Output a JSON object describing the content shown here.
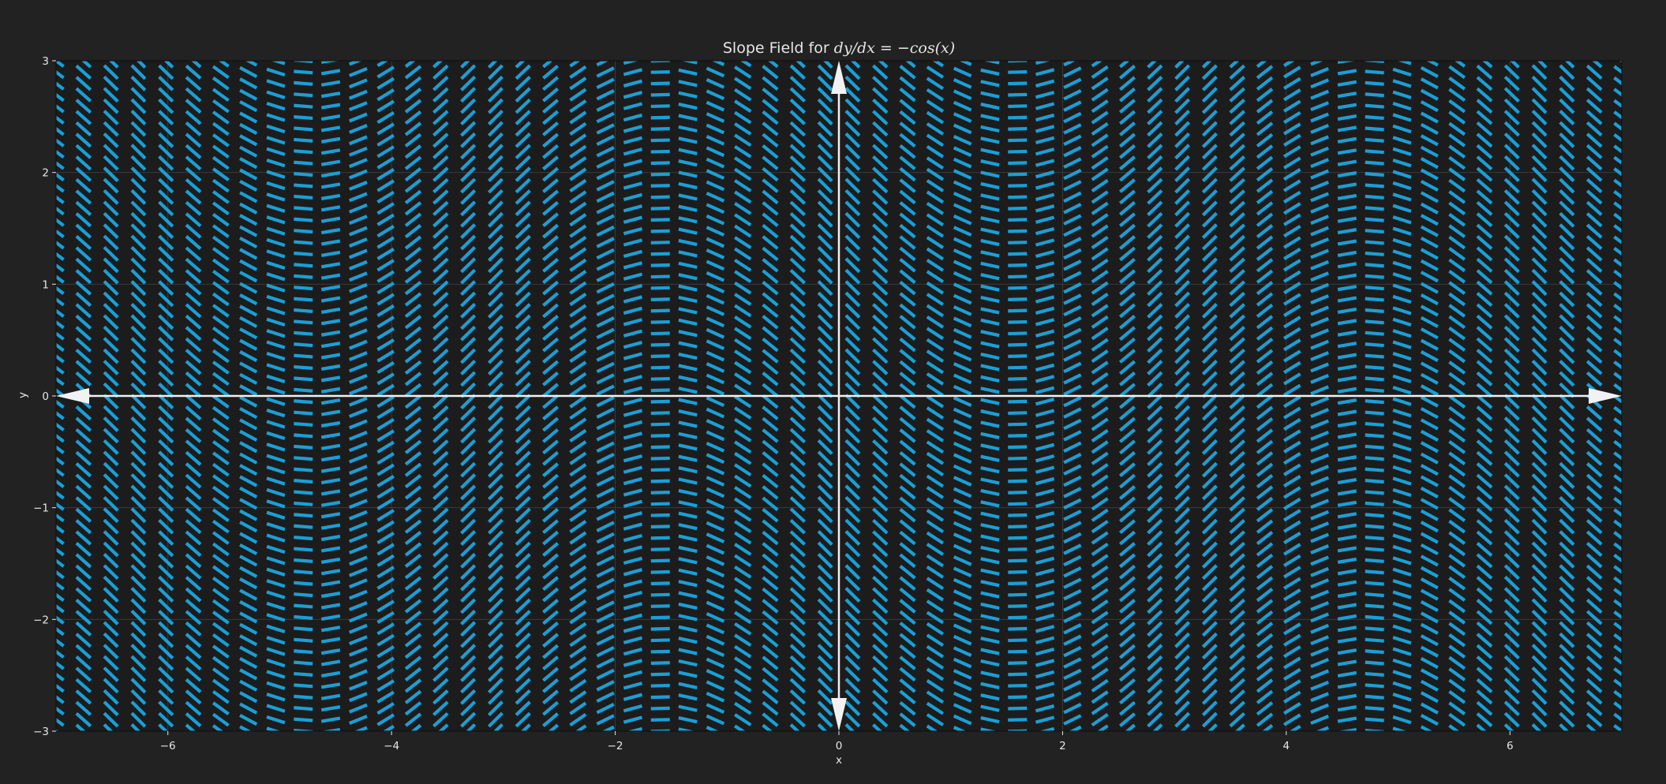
{
  "chart_data": {
    "type": "slope_field",
    "title_prefix": "Slope Field for ",
    "title_math": "dy/dx = −cos(x)",
    "xlabel": "x",
    "ylabel": "y",
    "xlim": [
      -7,
      7
    ],
    "ylim": [
      -3,
      3
    ],
    "xticks": [
      -6,
      -4,
      -2,
      0,
      2,
      4,
      6
    ],
    "xtick_labels": [
      "−6",
      "−4",
      "−2",
      "0",
      "2",
      "4",
      "6"
    ],
    "yticks": [
      -3,
      -2,
      -1,
      0,
      1,
      2,
      3
    ],
    "ytick_labels": [
      "−3",
      "−2",
      "−1",
      "0",
      "1",
      "2",
      "3"
    ],
    "equation": "dy/dx = -cos(x)",
    "field_samples": {
      "x_start": -7,
      "x_end": 7,
      "x_count": 58,
      "y_start": -3,
      "y_end": 3,
      "y_count": 60
    },
    "grid": true,
    "axes_arrows": true,
    "colors": {
      "background": "#222222",
      "segments": "#1a9fd6",
      "axes_arrows": "#f2f2f2",
      "grid": "#3a3a3a",
      "text": "#e6e6e6"
    }
  }
}
